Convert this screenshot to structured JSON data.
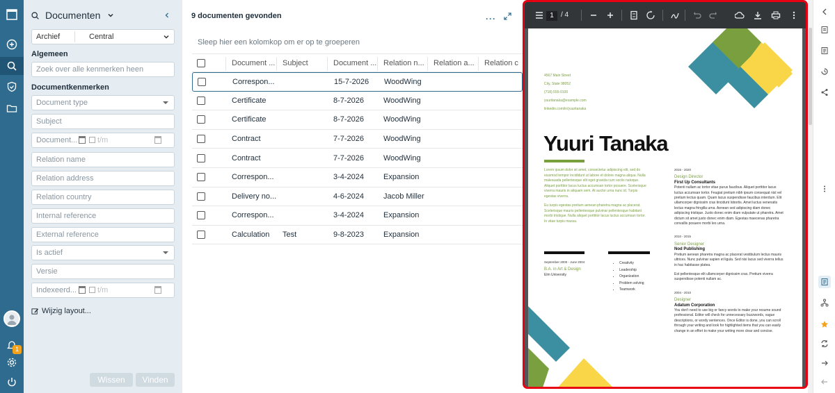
{
  "app": {
    "title": "Documenten"
  },
  "search": {
    "archive_label": "Archief",
    "archive_value": "Central",
    "section_general": "Algemeen",
    "general_search_placeholder": "Zoek over alle kenmerken heen",
    "section_doc_properties": "Documentkenmerken",
    "fields": {
      "document_type": "Document type",
      "subject": "Subject",
      "document_date": "Document...",
      "date_to": "t/m",
      "relation_name": "Relation name",
      "relation_address": "Relation address",
      "relation_country": "Relation country",
      "internal_reference": "Internal reference",
      "external_reference": "External reference",
      "is_active": "Is actief",
      "version": "Versie",
      "indexed": "Indexeerd...",
      "indexed_to": "t/m"
    },
    "change_layout": "Wijzig layout...",
    "clear_button": "Wissen",
    "find_button": "Vinden"
  },
  "results": {
    "count_text": "9 documenten gevonden",
    "group_hint": "Sleep hier een kolomkop om er op te groeperen",
    "columns": [
      "Document ...",
      "Subject",
      "Document ...",
      "Relation n...",
      "Relation a...",
      "Relation c"
    ],
    "rows": [
      {
        "type": "Correspon...",
        "subject": "",
        "date": "15-7-2026",
        "relation": "WoodWing"
      },
      {
        "type": "Certificate",
        "subject": "",
        "date": "8-7-2026",
        "relation": "WoodWing"
      },
      {
        "type": "Certificate",
        "subject": "",
        "date": "8-7-2026",
        "relation": "WoodWing"
      },
      {
        "type": "Contract",
        "subject": "",
        "date": "7-7-2026",
        "relation": "WoodWing"
      },
      {
        "type": "Contract",
        "subject": "",
        "date": "7-7-2026",
        "relation": "WoodWing"
      },
      {
        "type": "Correspon...",
        "subject": "",
        "date": "3-4-2024",
        "relation": "Expansion"
      },
      {
        "type": "Delivery no...",
        "subject": "",
        "date": "4-6-2024",
        "relation": "Jacob Miller"
      },
      {
        "type": "Correspon...",
        "subject": "",
        "date": "3-4-2024",
        "relation": "Expansion"
      },
      {
        "type": "Calculation",
        "subject": "Test",
        "date": "9-8-2023",
        "relation": "Expansion"
      }
    ]
  },
  "viewer": {
    "page_current": "1",
    "page_total": "/ 4",
    "resume": {
      "contact": [
        "4567 Main Street",
        "City, State 98052",
        "(718) 555-0100",
        "yuuritanaka@example.com",
        "linkedin.com/in/yuuritanaka"
      ],
      "name": "Yuuri Tanaka",
      "intro1": "Lorem ipsum dolor sit amet, consectetur adipiscing elit, sed do eiusmod tempor incididunt ut labore et dolore magna aliqua. Nulla malesuada pellentesque elit eget gravida cum sociis natoque. Aliquet porttitor lacus luctus accumsan tortor posuere. Scelerisque viverra mauris in aliquam sem. At auctor urna nunc id. Turpis egestas viverra.",
      "intro2": "Eu turpis egestas pretium aenean pharetra magna ac placerat. Scelerisque mauris pellentesque pulvinar pellentesque habitant morbi tristique. Nulla aliquet porttitor lacus luctus accumsan tortor. In vitae turpis massa.",
      "edu_dates": "September 2000 - June 2004",
      "edu_degree": "B.A. in Art & Design",
      "edu_school": "Elm University",
      "skills": [
        "Creativity",
        "Leadership",
        "Organization",
        "Problem solving",
        "Teamwork"
      ],
      "jobs": [
        {
          "dates": "2015 - 2020",
          "title": "Design Director",
          "company": "First Up Consultants",
          "desc": "Potenti nullam ac tortor vitae purus faucibus. Aliquet porttitor lacus luctus accumsan tortor. Feugiat pretium nibh ipsum consequat nisl vel pretium lectus quam. Quam lacus suspendisse faucibus interdum. Elit ullamcorper dignissim cras tincidunt lobortis. Amet luctus venenatis lectus magna fringilla urna. Aenean sed adipiscing diam donec adipiscing tristique. Justo donec enim diam vulputate ut pharetra. Amet dictum sit amet justo donec enim diam. Egestas maecenas pharetra convallis posuere morbi leo urna."
        },
        {
          "dates": "2010 - 2015",
          "title": "Senior Designer",
          "company": "Nod Publishing",
          "desc": "Pretium aenean pharetra magna ac placerat vestibulum lectus mauris ultrices. Nunc pulvinar sapien et ligula. Sed nisi lacus sed viverra tellus in hac habitasse platea.",
          "desc2": "Est pellentesque elit ullamcorper dignissim cras. Pretium viverra suspendisse potenti nullam ac."
        },
        {
          "dates": "2004 - 2010",
          "title": "Designer",
          "company": "Adatum Corporation",
          "desc": "You don't need to use big or fancy words to make your resume sound professional. Editor will check for unnecessary buzzwords, vague descriptions, or wordy sentences. Once Editor is done, you can scroll through your writing and look for highlighted items that you can easily change in an effort to make your writing more clear and concise."
        }
      ]
    }
  },
  "colors": {
    "rail": "#2f6b8f",
    "panel": "#e6edf2",
    "accent_green": "#7a9f3f",
    "accent_yellow": "#f9d647",
    "accent_teal": "#3b8fa0",
    "highlight_border": "#e60012"
  }
}
